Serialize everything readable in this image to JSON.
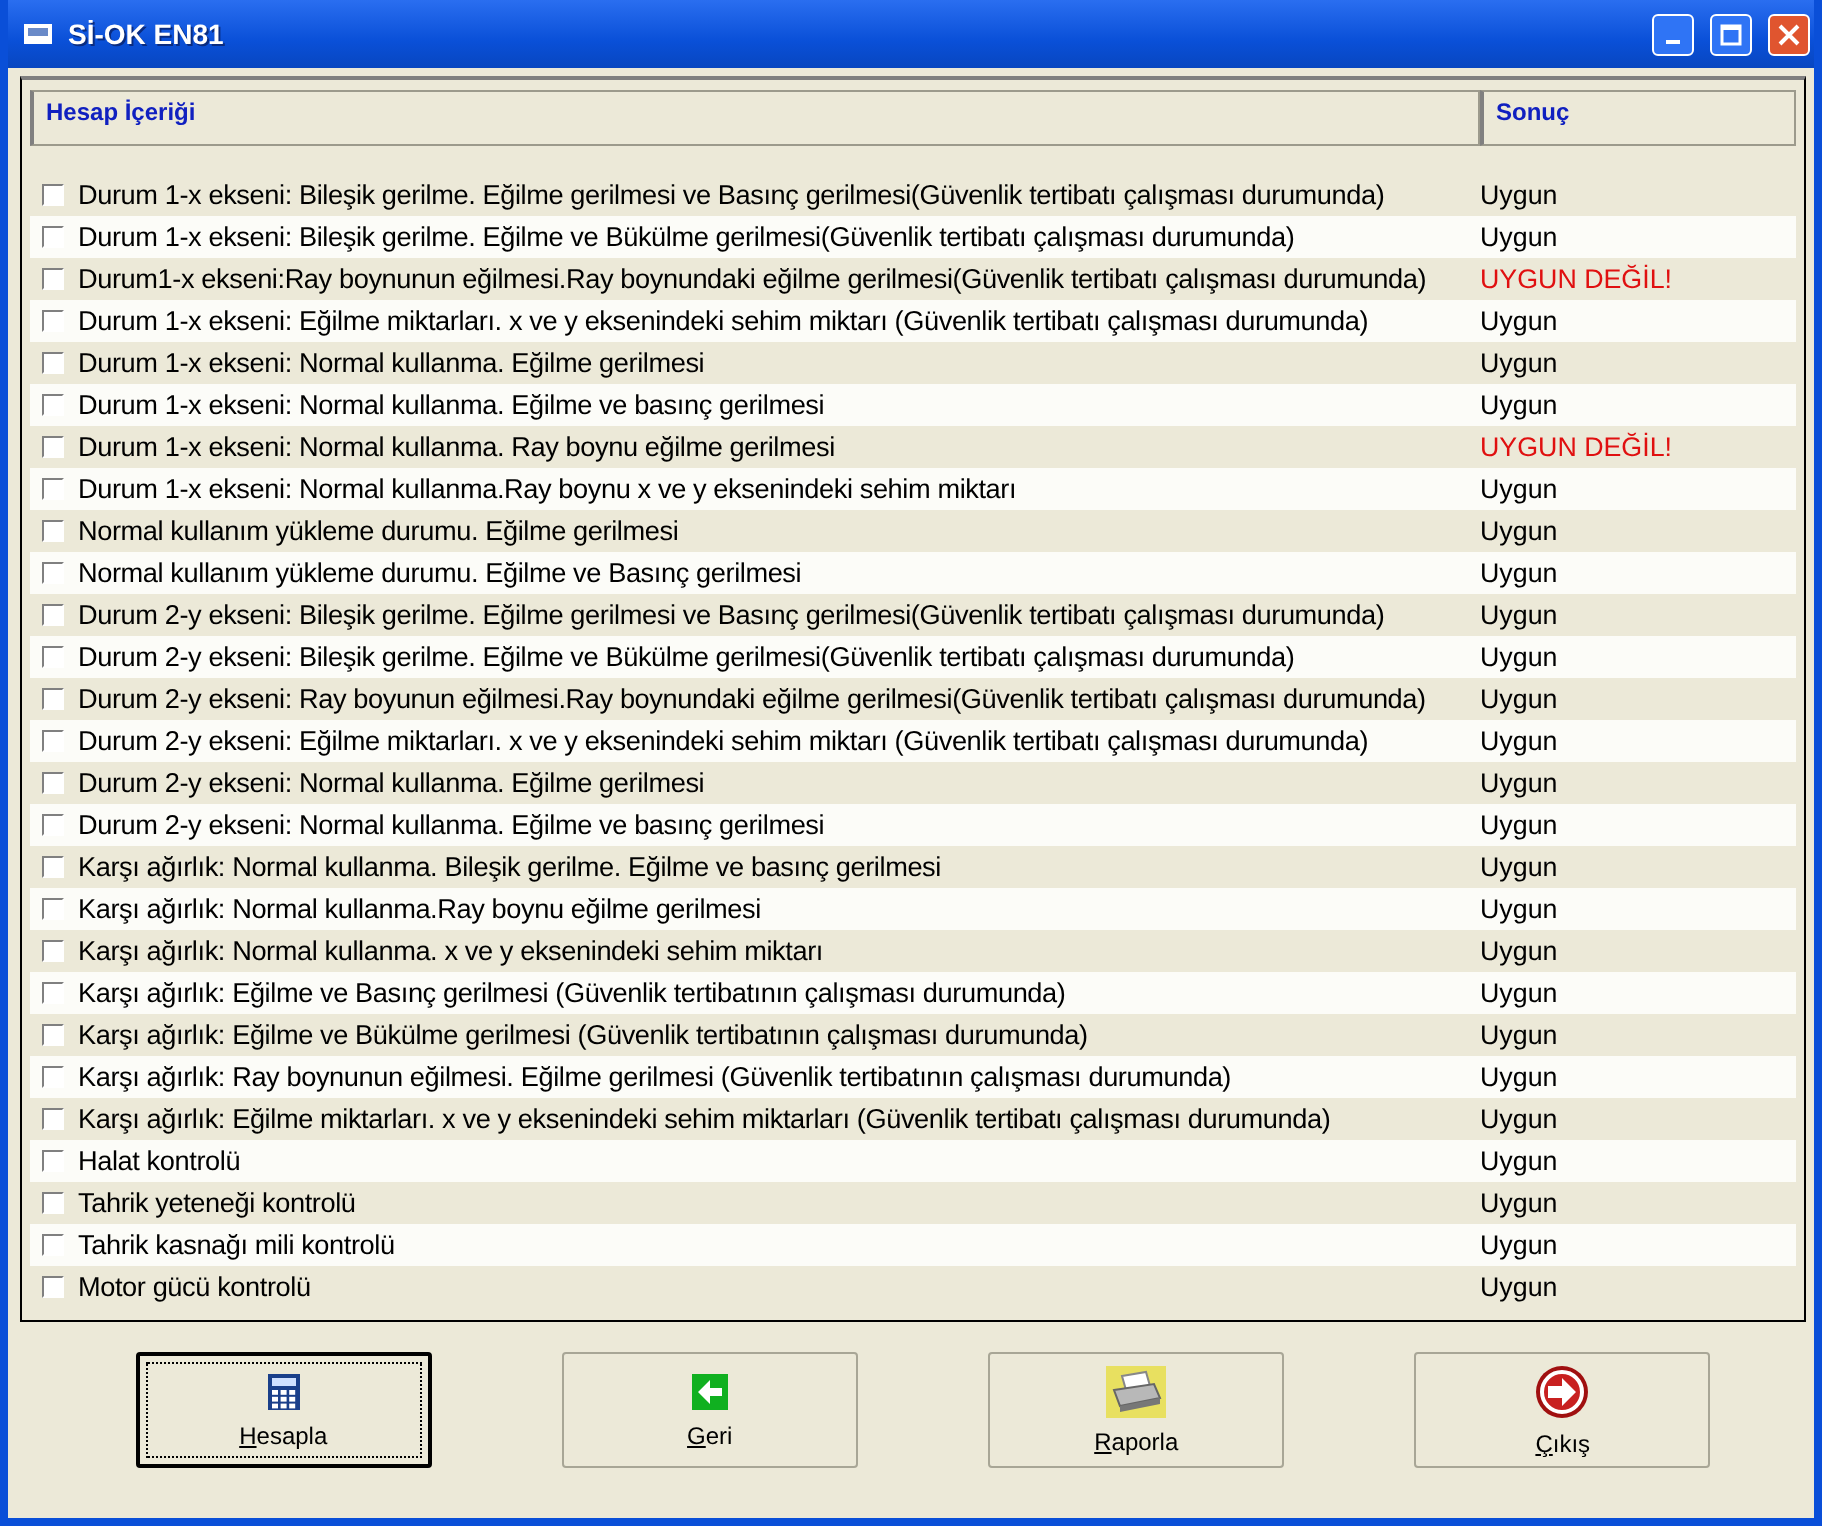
{
  "window": {
    "title": "Sİ-OK EN81"
  },
  "table": {
    "columns": [
      "Hesap İçeriği",
      "Sonuç"
    ],
    "rows": [
      {
        "label": "Durum 1-x ekseni: Bileşik gerilme. Eğilme gerilmesi ve Basınç gerilmesi(Güvenlik tertibatı çalışması durumunda)",
        "result": "Uygun",
        "failed": false,
        "checked": false
      },
      {
        "label": "Durum 1-x ekseni: Bileşik gerilme. Eğilme ve Bükülme gerilmesi(Güvenlik tertibatı çalışması durumunda)",
        "result": "Uygun",
        "failed": false,
        "checked": false
      },
      {
        "label": "Durum1-x ekseni:Ray boynunun eğilmesi.Ray boynundaki eğilme gerilmesi(Güvenlik tertibatı çalışması durumunda)",
        "result": "UYGUN DEĞİL!",
        "failed": true,
        "checked": false
      },
      {
        "label": "Durum 1-x ekseni: Eğilme miktarları. x ve y eksenindeki sehim miktarı (Güvenlik tertibatı çalışması durumunda)",
        "result": "Uygun",
        "failed": false,
        "checked": false
      },
      {
        "label": "Durum 1-x ekseni: Normal kullanma. Eğilme gerilmesi",
        "result": "Uygun",
        "failed": false,
        "checked": false
      },
      {
        "label": "Durum 1-x ekseni: Normal kullanma. Eğilme ve basınç gerilmesi",
        "result": "Uygun",
        "failed": false,
        "checked": false
      },
      {
        "label": "Durum 1-x ekseni: Normal kullanma. Ray boynu eğilme gerilmesi",
        "result": "UYGUN DEĞİL!",
        "failed": true,
        "checked": false
      },
      {
        "label": "Durum 1-x ekseni: Normal kullanma.Ray boynu x ve y eksenindeki sehim miktarı",
        "result": "Uygun",
        "failed": false,
        "checked": false
      },
      {
        "label": "Normal kullanım yükleme durumu. Eğilme gerilmesi",
        "result": "Uygun",
        "failed": false,
        "checked": false
      },
      {
        "label": "Normal kullanım yükleme durumu. Eğilme ve Basınç gerilmesi",
        "result": "Uygun",
        "failed": false,
        "checked": false
      },
      {
        "label": "Durum 2-y ekseni: Bileşik gerilme. Eğilme gerilmesi ve Basınç gerilmesi(Güvenlik tertibatı çalışması durumunda)",
        "result": "Uygun",
        "failed": false,
        "checked": false
      },
      {
        "label": "Durum 2-y ekseni: Bileşik gerilme. Eğilme ve Bükülme gerilmesi(Güvenlik tertibatı çalışması durumunda)",
        "result": "Uygun",
        "failed": false,
        "checked": false
      },
      {
        "label": "Durum 2-y ekseni: Ray boyunun eğilmesi.Ray boynundaki eğilme gerilmesi(Güvenlik tertibatı çalışması durumunda)",
        "result": "Uygun",
        "failed": false,
        "checked": false
      },
      {
        "label": "Durum 2-y ekseni: Eğilme miktarları. x ve y eksenindeki sehim miktarı (Güvenlik tertibatı çalışması durumunda)",
        "result": "Uygun",
        "failed": false,
        "checked": false
      },
      {
        "label": "Durum 2-y ekseni: Normal kullanma. Eğilme gerilmesi",
        "result": "Uygun",
        "failed": false,
        "checked": false
      },
      {
        "label": "Durum 2-y ekseni: Normal kullanma. Eğilme ve basınç gerilmesi",
        "result": "Uygun",
        "failed": false,
        "checked": false
      },
      {
        "label": "Karşı ağırlık: Normal kullanma. Bileşik gerilme. Eğilme ve basınç gerilmesi",
        "result": "Uygun",
        "failed": false,
        "checked": false
      },
      {
        "label": "Karşı ağırlık: Normal kullanma.Ray boynu eğilme gerilmesi",
        "result": "Uygun",
        "failed": false,
        "checked": false
      },
      {
        "label": "Karşı ağırlık: Normal kullanma. x ve y eksenindeki sehim miktarı",
        "result": "Uygun",
        "failed": false,
        "checked": false
      },
      {
        "label": "Karşı ağırlık: Eğilme ve Basınç gerilmesi (Güvenlik tertibatının çalışması durumunda)",
        "result": "Uygun",
        "failed": false,
        "checked": false
      },
      {
        "label": "Karşı ağırlık: Eğilme ve Bükülme gerilmesi (Güvenlik tertibatının çalışması durumunda)",
        "result": "Uygun",
        "failed": false,
        "checked": false
      },
      {
        "label": "Karşı ağırlık: Ray boynunun eğilmesi. Eğilme gerilmesi (Güvenlik tertibatının çalışması durumunda)",
        "result": "Uygun",
        "failed": false,
        "checked": false
      },
      {
        "label": "Karşı ağırlık: Eğilme miktarları. x ve y eksenindeki sehim miktarları (Güvenlik tertibatı çalışması durumunda)",
        "result": "Uygun",
        "failed": false,
        "checked": false
      },
      {
        "label": "Halat kontrolü",
        "result": "Uygun",
        "failed": false,
        "checked": false
      },
      {
        "label": "Tahrik yeteneği kontrolü",
        "result": "Uygun",
        "failed": false,
        "checked": false
      },
      {
        "label": "Tahrik kasnağı mili kontrolü",
        "result": "Uygun",
        "failed": false,
        "checked": false
      },
      {
        "label": "Motor gücü kontrolü",
        "result": "Uygun",
        "failed": false,
        "checked": false
      }
    ]
  },
  "buttons": [
    {
      "label": "Hesapla",
      "kind": "calculate",
      "focused": true
    },
    {
      "label": "Geri",
      "kind": "back",
      "focused": false
    },
    {
      "label": "Raporla",
      "kind": "report",
      "focused": false
    },
    {
      "label": "Çıkış",
      "kind": "exit",
      "focused": false
    }
  ]
}
